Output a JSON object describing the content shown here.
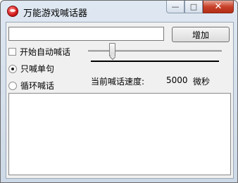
{
  "window": {
    "title": "万能游戏喊话器",
    "minimize_glyph": "—",
    "maximize_glyph": "□",
    "close_glyph": "✕"
  },
  "input": {
    "value": "",
    "add_button_label": "增加"
  },
  "options": {
    "auto_shout_label": "开始自动喊话",
    "auto_shout_checked": false,
    "modes": [
      {
        "label": "只喊单句",
        "selected": true
      },
      {
        "label": "循环喊话",
        "selected": false
      }
    ]
  },
  "speed": {
    "label": "当前喊话速度:",
    "value": "5000",
    "unit": "微秒",
    "slider_level": 0.18
  },
  "log": {
    "content": ""
  }
}
